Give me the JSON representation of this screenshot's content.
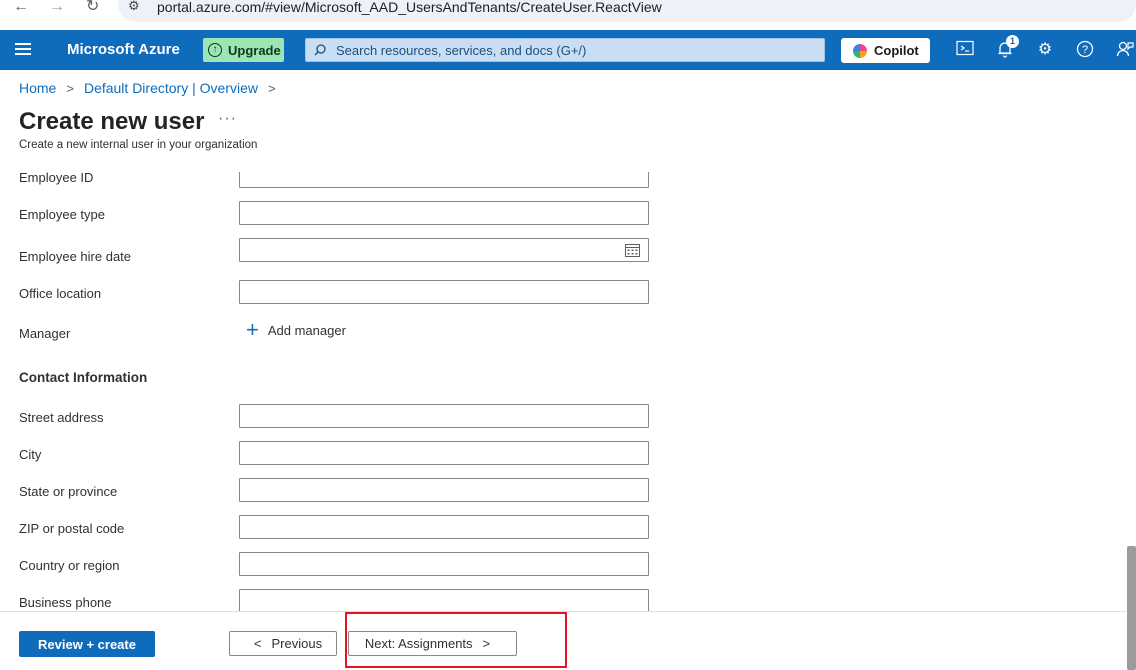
{
  "browser": {
    "url": "portal.azure.com/#view/Microsoft_AAD_UsersAndTenants/CreateUser.ReactView",
    "back_icon": "back-arrow-icon",
    "forward_icon": "forward-arrow-icon",
    "reload_icon": "reload-icon"
  },
  "header": {
    "brand": "Microsoft Azure",
    "upgrade_label": "Upgrade",
    "search_placeholder": "Search resources, services, and docs (G+/)",
    "copilot_label": "Copilot",
    "notification_count": "1",
    "accent_color": "#0f6cbd"
  },
  "breadcrumb": {
    "items": [
      "Home",
      "Default Directory | Overview"
    ]
  },
  "page": {
    "title": "Create new user",
    "more_label": "···",
    "subtitle": "Create a new internal user in your organization"
  },
  "form": {
    "employee_id_label": "Employee ID",
    "employee_type_label": "Employee type",
    "hire_date_label": "Employee hire date",
    "office_location_label": "Office location",
    "manager_label": "Manager",
    "add_manager_label": "Add manager",
    "contact_heading": "Contact Information",
    "street_label": "Street address",
    "city_label": "City",
    "state_label": "State or province",
    "zip_label": "ZIP or postal code",
    "country_label": "Country or region",
    "business_phone_label": "Business phone"
  },
  "footer": {
    "review_label": "Review + create",
    "previous_label": "Previous",
    "next_label": "Next: Assignments"
  }
}
